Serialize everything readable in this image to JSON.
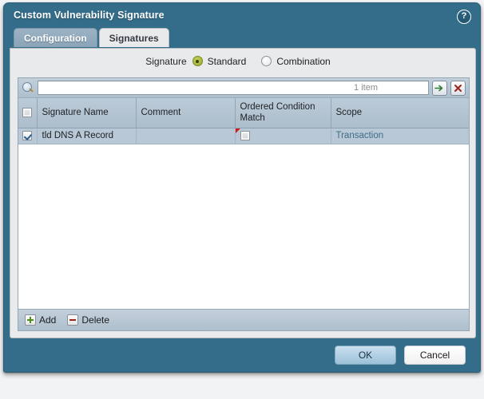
{
  "dialog": {
    "title": "Custom Vulnerability Signature",
    "help_icon": "?",
    "accent_color": "#336d8a",
    "panel_color": "#e9eaec"
  },
  "tabs": [
    {
      "label": "Configuration",
      "active": false
    },
    {
      "label": "Signatures",
      "active": true
    }
  ],
  "signature_type": {
    "label": "Signature",
    "options": [
      {
        "label": "Standard",
        "selected": true
      },
      {
        "label": "Combination",
        "selected": false
      }
    ],
    "selected_color": "#a9b83d"
  },
  "search": {
    "value": "",
    "placeholder": "",
    "icon": "search-icon",
    "item_count": "1 item",
    "apply_icon": "green-arrow-icon",
    "clear_icon": "red-x-icon"
  },
  "table": {
    "columns": [
      {
        "key": "select",
        "label": ""
      },
      {
        "key": "name",
        "label": "Signature Name"
      },
      {
        "key": "comment",
        "label": "Comment"
      },
      {
        "key": "ordered_condition_match",
        "label": "Ordered Condition Match"
      },
      {
        "key": "scope",
        "label": "Scope"
      }
    ],
    "header_select_all_checked": false,
    "rows": [
      {
        "selected": true,
        "name": "tld DNS A Record",
        "comment": "",
        "ordered_condition_match": false,
        "ordered_condition_match_flagged": true,
        "scope": "Transaction"
      }
    ]
  },
  "grid_actions": [
    {
      "label": "Add",
      "icon": "plus-icon"
    },
    {
      "label": "Delete",
      "icon": "minus-icon"
    }
  ],
  "footer": {
    "ok_label": "OK",
    "cancel_label": "Cancel"
  }
}
